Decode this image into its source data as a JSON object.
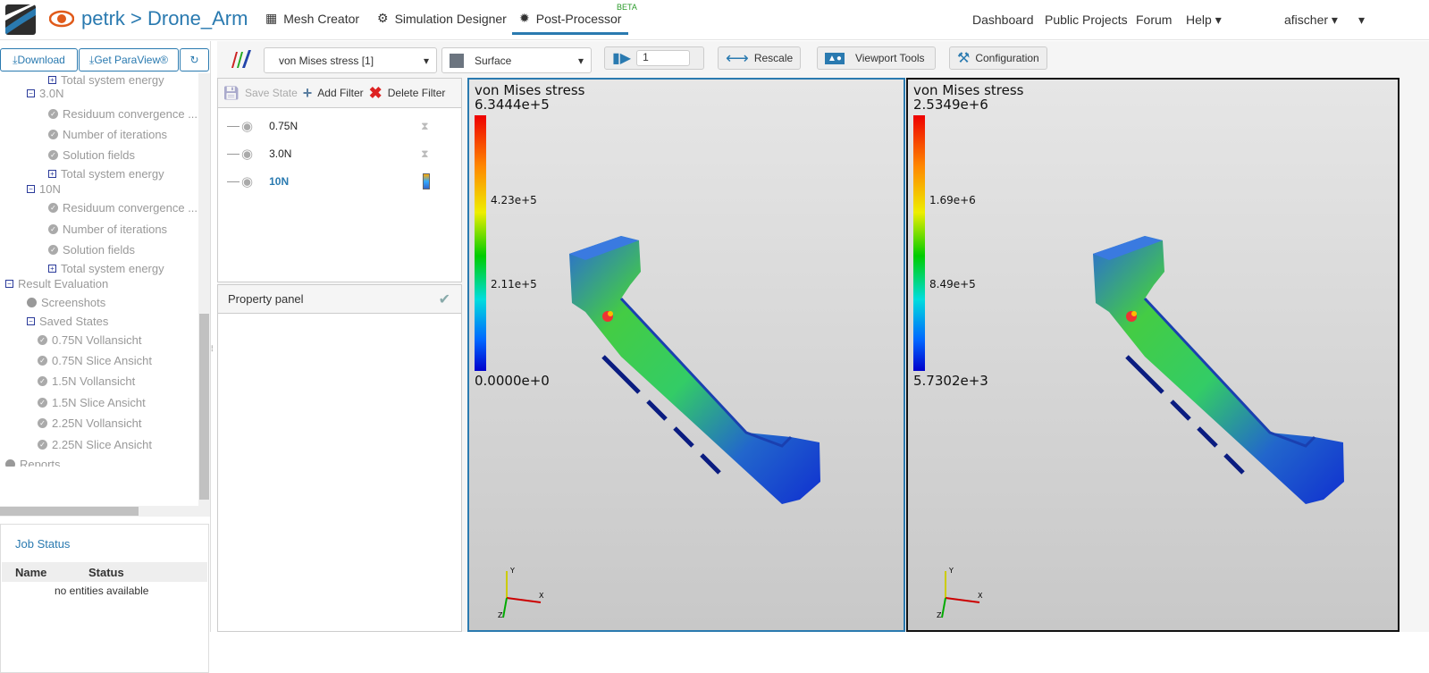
{
  "header": {
    "breadcrumb": "petrk > Drone_Arm",
    "nav": [
      "Mesh Creator",
      "Simulation Designer",
      "Post-Processor"
    ],
    "beta": "BETA",
    "right_nav": [
      "Dashboard",
      "Public Projects",
      "Forum",
      "Help"
    ],
    "user": "afischer"
  },
  "sidebar": {
    "buttons": [
      "Download",
      "Get ParaView®"
    ],
    "tree": [
      {
        "label": "Total system energy",
        "icon": "plus",
        "indent": 2
      },
      {
        "label": "3.0N",
        "icon": "minus",
        "indent": 1
      },
      {
        "label": "Residuum convergence ...",
        "icon": "check",
        "indent": 2
      },
      {
        "label": "Number of iterations",
        "icon": "check",
        "indent": 2
      },
      {
        "label": "Solution fields",
        "icon": "check",
        "indent": 2
      },
      {
        "label": "Total system energy",
        "icon": "plus",
        "indent": 2
      },
      {
        "label": "10N",
        "icon": "minus",
        "indent": 1
      },
      {
        "label": "Residuum convergence ...",
        "icon": "check",
        "indent": 2
      },
      {
        "label": "Number of iterations",
        "icon": "check",
        "indent": 2
      },
      {
        "label": "Solution fields",
        "icon": "check",
        "indent": 2
      },
      {
        "label": "Total system energy",
        "icon": "plus",
        "indent": 2
      },
      {
        "label": "Result Evaluation",
        "icon": "minus",
        "indent": 0
      },
      {
        "label": "Screenshots",
        "icon": "dot",
        "indent": 1
      },
      {
        "label": "Saved States",
        "icon": "minus",
        "indent": 1
      },
      {
        "label": "0.75N Vollansicht",
        "icon": "check",
        "indent": 1.5
      },
      {
        "label": "0.75N Slice Ansicht",
        "icon": "check",
        "indent": 1.5
      },
      {
        "label": "1.5N Vollansicht",
        "icon": "check",
        "indent": 1.5
      },
      {
        "label": "1.5N Slice Ansicht",
        "icon": "check",
        "indent": 1.5
      },
      {
        "label": "2.25N Vollansicht",
        "icon": "check",
        "indent": 1.5
      },
      {
        "label": "2.25N Slice Ansicht",
        "icon": "check",
        "indent": 1.5
      },
      {
        "label": "Reports",
        "icon": "dot",
        "indent": 0
      }
    ]
  },
  "job_status": {
    "title": "Job Status",
    "columns": [
      "Name",
      "Status"
    ],
    "empty": "no entities available"
  },
  "toolbar": {
    "field": "von Mises stress [1]",
    "representation": "Surface",
    "timestep": "1",
    "rescale": "Rescale",
    "viewport_tools": "Viewport Tools",
    "configuration": "Configuration"
  },
  "filters": {
    "save_state": "Save State",
    "add_filter": "Add Filter",
    "delete_filter": "Delete Filter",
    "items": [
      "0.75N",
      "3.0N",
      "10N"
    ]
  },
  "property_panel": "Property panel",
  "viewports": [
    {
      "title": "von Mises stress",
      "max": "6.3444e+5",
      "ticks": [
        "4.23e+5",
        "2.11e+5"
      ],
      "min": "0.0000e+0"
    },
    {
      "title": "von Mises stress",
      "max": "2.5349e+6",
      "ticks": [
        "1.69e+6",
        "8.49e+5"
      ],
      "min": "5.7302e+3"
    }
  ],
  "colors": {
    "accent": "#2a7ab0"
  }
}
